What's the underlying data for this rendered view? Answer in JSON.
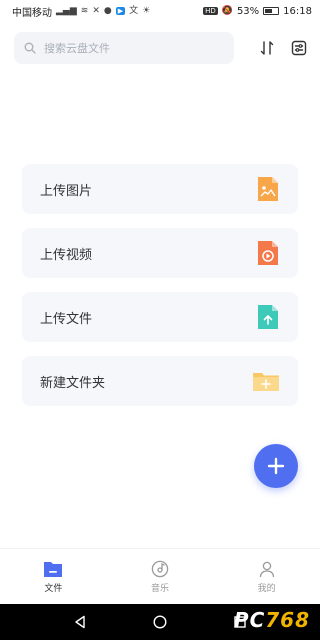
{
  "status_bar": {
    "carrier": "中国移动",
    "battery": "53%",
    "time": "16:18",
    "hd_badge": "HD"
  },
  "search": {
    "placeholder": "搜索云盘文件"
  },
  "actions": [
    {
      "label": "上传图片",
      "icon": "image-file-icon",
      "color": "#f7a64a"
    },
    {
      "label": "上传视频",
      "icon": "video-file-icon",
      "color": "#f3784a"
    },
    {
      "label": "上传文件",
      "icon": "upload-file-icon",
      "color": "#3fc9b8"
    },
    {
      "label": "新建文件夹",
      "icon": "new-folder-icon",
      "color": "#f8c864"
    }
  ],
  "tabs": [
    {
      "label": "文件",
      "icon": "folder-icon",
      "active": true
    },
    {
      "label": "音乐",
      "icon": "music-disc-icon",
      "active": false
    },
    {
      "label": "我的",
      "icon": "person-icon",
      "active": false
    }
  ],
  "colors": {
    "accent": "#4f6ef0",
    "card_bg": "#f5f7fb"
  },
  "watermark": {
    "text_a": "PC",
    "text_b": "768"
  }
}
